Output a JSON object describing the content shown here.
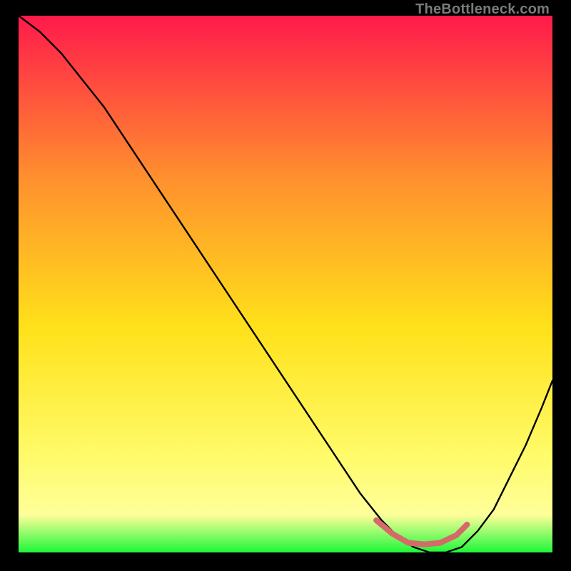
{
  "watermark": "TheBottleneck.com",
  "colors": {
    "gradient_top": "#ff1a4b",
    "gradient_upper_mid": "#ff8f2e",
    "gradient_mid": "#ffe11a",
    "gradient_low": "#fffb6a",
    "gradient_band": "#ffff9a",
    "gradient_bottom": "#1ef73a",
    "curve": "#000000",
    "overlay_segment": "#d46a6a",
    "frame_bg": "#000000"
  },
  "chart_data": {
    "type": "line",
    "title": "",
    "xlabel": "",
    "ylabel": "",
    "xlim": [
      0,
      100
    ],
    "ylim": [
      0,
      100
    ],
    "series": [
      {
        "name": "bottleneck-curve",
        "x": [
          0,
          4,
          8,
          12,
          16,
          20,
          24,
          28,
          32,
          36,
          40,
          44,
          48,
          52,
          56,
          60,
          64,
          68,
          71,
          74,
          77,
          80,
          83,
          86,
          89,
          92,
          95,
          98,
          100
        ],
        "values": [
          100,
          97,
          93,
          88,
          83,
          77,
          71,
          65,
          59,
          53,
          47,
          41,
          35,
          29,
          23,
          17,
          11,
          6,
          3,
          1,
          0,
          0,
          1,
          4,
          8,
          14,
          20,
          27,
          32
        ]
      }
    ],
    "overlay_segment": {
      "name": "highlight-band",
      "x": [
        67,
        70,
        73,
        76,
        79,
        82,
        84
      ],
      "values": [
        6,
        3.5,
        1.8,
        1.5,
        1.8,
        3.2,
        5.2
      ]
    }
  }
}
